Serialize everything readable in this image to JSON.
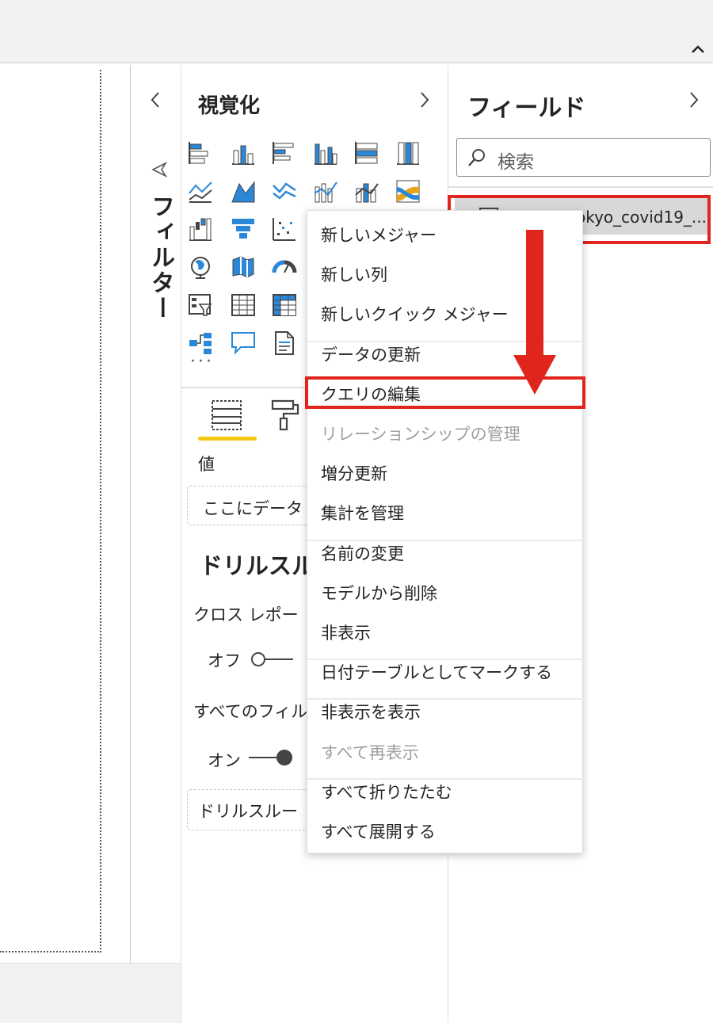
{
  "filters": {
    "label": "フィルター"
  },
  "visualizations": {
    "title": "視覚化",
    "values_label": "値",
    "values_placeholder": "ここにデータ",
    "drillthrough_title": "ドリルスル",
    "cross_report_label": "クロス レポー",
    "cross_report_toggle_label": "オフ",
    "keep_all_filters_label": "すべてのフィル",
    "keep_all_filters_toggle_label": "オン",
    "drillthrough_placeholder": "ドリルスルー",
    "more": "···"
  },
  "fields": {
    "title": "フィールド",
    "search_placeholder": "検索",
    "table_name": "okyo_covid19_..."
  },
  "context_menu": {
    "groups": [
      [
        "新しいメジャー",
        "新しい列",
        "新しいクイック メジャー"
      ],
      [
        "データの更新",
        "クエリの編集",
        "リレーションシップの管理",
        "増分更新",
        "集計を管理"
      ],
      [
        "名前の変更",
        "モデルから削除",
        "非表示"
      ],
      [
        "日付テーブルとしてマークする"
      ],
      [
        "非表示を表示",
        "すべて再表示"
      ],
      [
        "すべて折りたたむ",
        "すべて展開する"
      ]
    ],
    "disabled_items": [
      "リレーションシップの管理",
      "すべて再表示"
    ],
    "highlighted_item": "クエリの編集"
  },
  "colors": {
    "highlight_red": "#e0261c",
    "accent_yellow": "#f2c811",
    "viz_icon_blue": "#2b88d8"
  },
  "viz_icons": [
    "stacked-bar-icon",
    "stacked-column-icon",
    "clustered-bar-icon",
    "clustered-column-icon",
    "100-stacked-bar-icon",
    "100-stacked-column-icon",
    "line-chart-icon",
    "area-chart-icon",
    "stacked-area-icon",
    "line-clustered-column-icon",
    "line-stacked-column-icon",
    "ribbon-chart-icon",
    "waterfall-icon",
    "funnel-icon",
    "scatter-icon",
    "globe-map-icon",
    "filled-map-icon",
    "gauge-icon",
    "slicer-icon",
    "table-icon",
    "matrix-icon",
    "decomposition-tree-icon",
    "qa-icon",
    "paginated-report-icon"
  ]
}
